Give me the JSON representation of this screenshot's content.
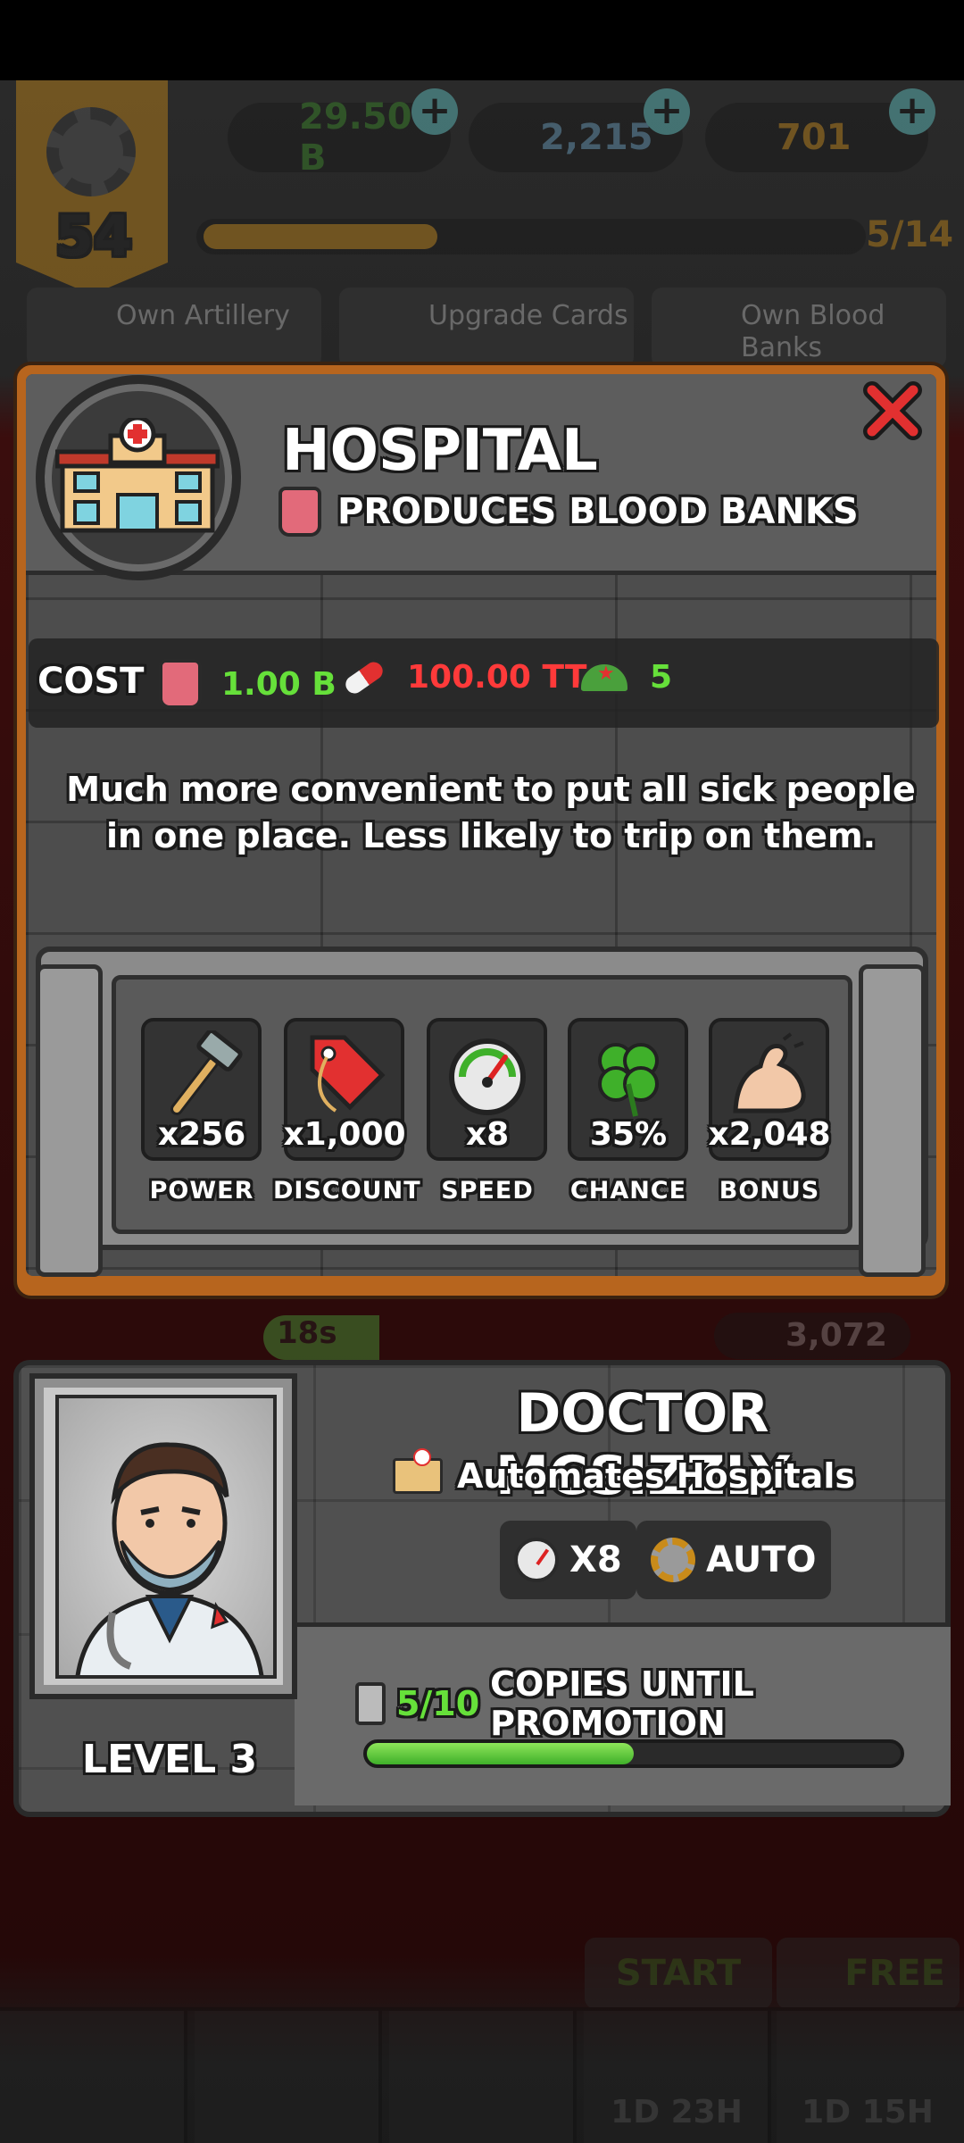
{
  "hud": {
    "level": "54",
    "resources": [
      {
        "value": "29.50 B",
        "color": "#3c8a2a"
      },
      {
        "value": "2,215",
        "color": "#6aa0c0"
      },
      {
        "value": "701",
        "color": "#c98b1a"
      }
    ],
    "progress_label": "5/14",
    "progress_value": 0.357
  },
  "quests": [
    "Own Artillery",
    "Upgrade Cards",
    "Own Blood Banks"
  ],
  "building": {
    "title": "HOSPITAL",
    "produces": "PRODUCES BLOOD BANKS",
    "cost_label": "COST",
    "costs": [
      {
        "value": "1.00 B",
        "color": "#66e03a",
        "icon": "blood-bank-icon"
      },
      {
        "value": "100.00 TT",
        "color": "#ff3a3a",
        "icon": "pill-icon"
      },
      {
        "value": "5",
        "color": "#66e03a",
        "icon": "army-cap-icon"
      }
    ],
    "description": "Much more convenient to put all sick people in one place. Less likely to trip on them.",
    "bonuses": [
      {
        "value": "x256",
        "label": "POWER",
        "icon": "hammer-icon"
      },
      {
        "value": "x1,000",
        "label": "DISCOUNT",
        "icon": "price-tag-icon"
      },
      {
        "value": "x8",
        "label": "SPEED",
        "icon": "speed-gauge-icon"
      },
      {
        "value": "35%",
        "label": "CHANCE",
        "icon": "clover-icon"
      },
      {
        "value": "x2,048",
        "label": "BONUS",
        "icon": "muscle-icon"
      }
    ]
  },
  "background_row": {
    "timer": "18s",
    "count": "3,072"
  },
  "manager": {
    "name": "DOCTOR MCSIZZLY",
    "automates": "Automates Hospitals",
    "speed_chip": "X8",
    "auto_chip": "AUTO",
    "level": "LEVEL 3",
    "copies_count": "5/10",
    "copies_text": "COPIES UNTIL PROMOTION",
    "copies_progress": 0.5
  },
  "bottom": {
    "start": "START",
    "free": "FREE",
    "timers": [
      "1D 23H",
      "1D 15H"
    ]
  },
  "colors": {
    "accent_gold": "#c98b1a",
    "modal_wood": "#b7651e",
    "panel_stone": "#4d4d4d",
    "close_red": "#e23030"
  }
}
